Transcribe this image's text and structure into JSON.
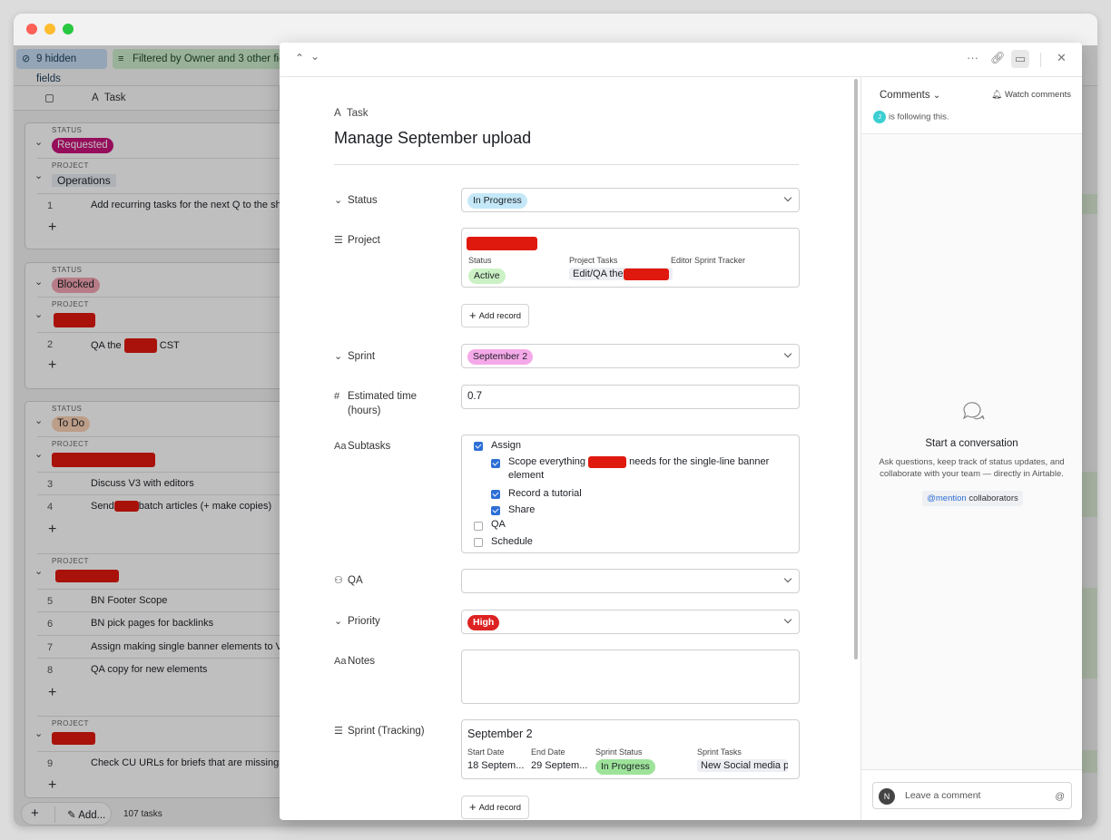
{
  "window": {
    "title": ""
  },
  "toolbar": {
    "hidden_fields": "9 hidden fields",
    "filter": "Filtered by Owner and 3 other fields"
  },
  "grid": {
    "column_task": "Task",
    "status_caption": "STATUS",
    "project_caption": "PROJECT",
    "groups": [
      {
        "status": "Requested",
        "status_color": "#c8127a",
        "project": "Operations",
        "rows": [
          {
            "num": "1",
            "text": "Add recurring tasks for the next Q to the sheet"
          }
        ]
      },
      {
        "status": "Blocked",
        "status_color": "#f4a6b4",
        "rows": [
          {
            "num": "2",
            "text_before": "QA the",
            "text_after": "CST"
          }
        ]
      },
      {
        "status": "To Do",
        "status_color": "#fcd3b6",
        "rows": [
          {
            "num": "3",
            "text": "Discuss V3 with editors"
          },
          {
            "num": "4",
            "text_before": "Send",
            "text_after": "batch articles (+ make copies)"
          }
        ]
      }
    ],
    "subgroup_rows_a": [
      {
        "num": "5",
        "text": "BN Footer Scope"
      },
      {
        "num": "6",
        "text": "BN pick pages for backlinks"
      },
      {
        "num": "7",
        "text": "Assign making single banner elements to V"
      },
      {
        "num": "8",
        "text": "QA copy for new elements"
      }
    ],
    "subgroup_rows_b": [
      {
        "num": "9",
        "text": "Check CU URLs for briefs that are missing t"
      }
    ],
    "add_label": "Add...",
    "task_count": "107 tasks"
  },
  "record": {
    "type_label": "Task",
    "title": "Manage September upload",
    "fields": {
      "status": {
        "label": "Status",
        "value": "In Progress",
        "color": "#c4e8f8"
      },
      "project": {
        "label": "Project",
        "sub_status_label": "Status",
        "sub_status_value": "Active",
        "project_tasks_label": "Project Tasks",
        "project_tasks_value": "Edit/QA the",
        "tracker_label": "Editor Sprint Tracker"
      },
      "add_record": "Add record",
      "sprint": {
        "label": "Sprint",
        "value": "September 2",
        "color": "#f5a9e8"
      },
      "estimated": {
        "label_line1": "Estimated time",
        "label_line2": "(hours)",
        "value": "0.7"
      },
      "subtasks": {
        "label": "Subtasks",
        "items": [
          {
            "text": "Assign",
            "checked": true
          },
          {
            "text_before": "Scope everything",
            "text_after": "needs for the single-line banner",
            "text_line2": "element",
            "checked": true
          },
          {
            "text": "Record a tutorial",
            "checked": true
          },
          {
            "text": "Share",
            "checked": true
          },
          {
            "text": "QA",
            "checked": false
          },
          {
            "text": "Schedule",
            "checked": false
          }
        ]
      },
      "qa": {
        "label": "QA",
        "value": ""
      },
      "priority": {
        "label": "Priority",
        "value": "High",
        "color": "#dd2222"
      },
      "notes": {
        "label": "Notes",
        "value": ""
      },
      "sprint_tracking": {
        "label": "Sprint (Tracking)",
        "name": "September 2",
        "start_label": "Start Date",
        "start_value": "18 Septem...",
        "end_label": "End Date",
        "end_value": "29 Septem...",
        "status_label": "Sprint Status",
        "status_value": "In Progress",
        "tasks_label": "Sprint Tasks",
        "tasks_value": "New Social media p"
      }
    }
  },
  "comments": {
    "header": "Comments",
    "watch": "Watch comments",
    "following": "is following this.",
    "avatar_letter": "J",
    "start_title": "Start a conversation",
    "start_desc": "Ask questions, keep track of status updates, and collaborate with your team — directly in Airtable.",
    "mention_at": "@mention",
    "mention_rest": " collaborators",
    "input_placeholder": "Leave a comment",
    "user_initial": "N"
  }
}
